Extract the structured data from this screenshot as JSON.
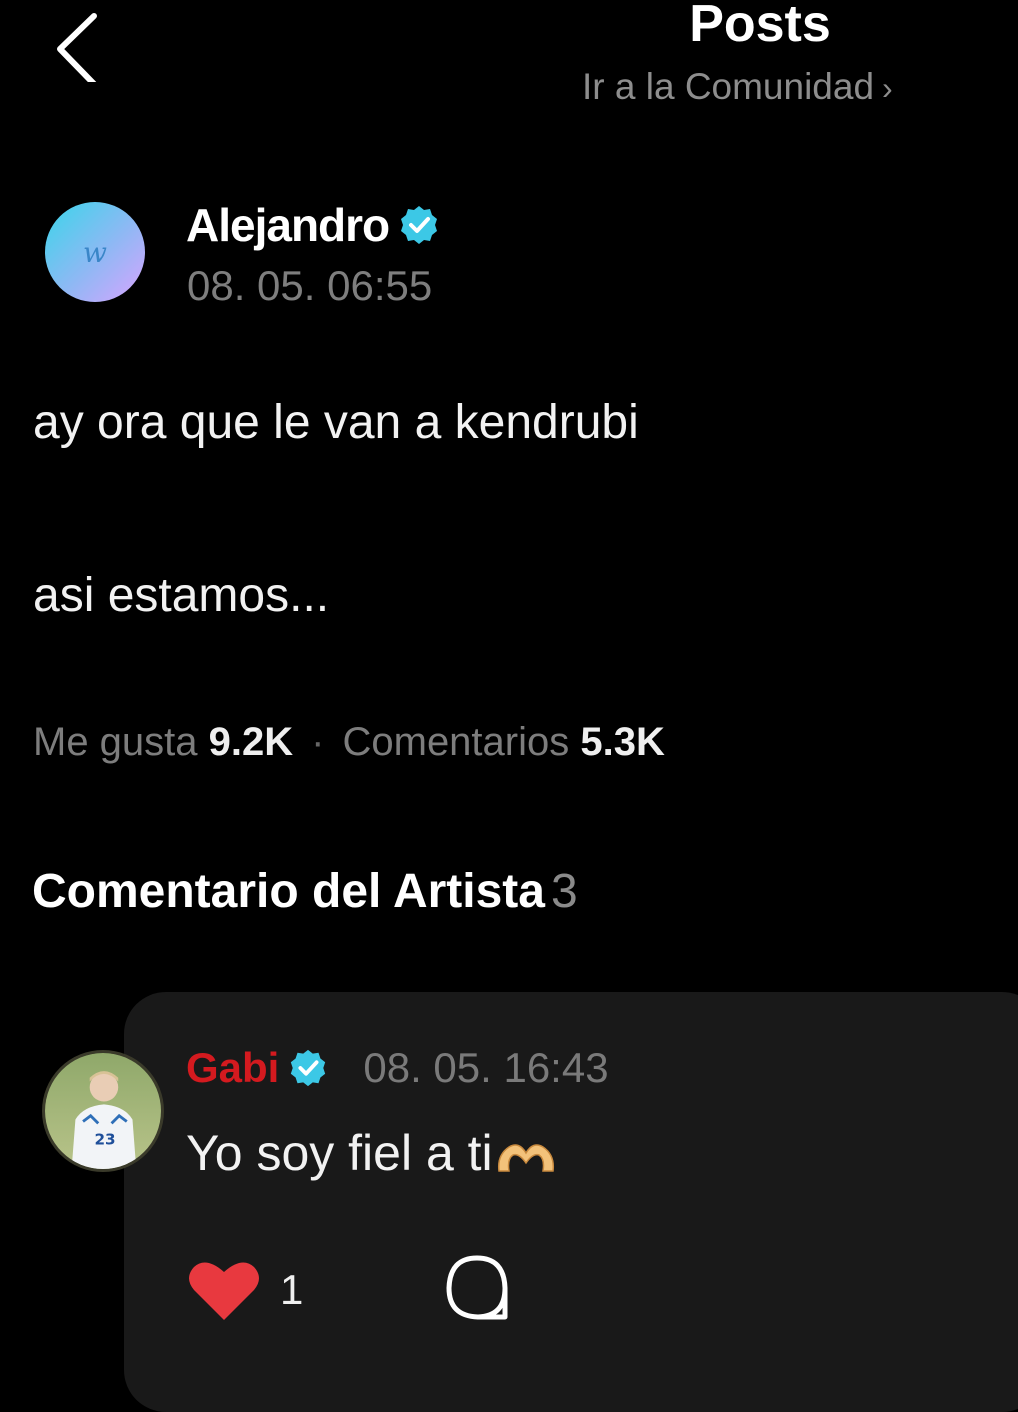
{
  "header": {
    "title": "Posts",
    "community_link": "Ir a la Comunidad",
    "back_icon": "chevron-left-icon"
  },
  "post": {
    "author": {
      "name": "Alejandro",
      "avatar_letter": "w",
      "verified": true
    },
    "timestamp": "08. 05. 06:55",
    "lines": [
      "ay ora que le van a kendrubi",
      "asi estamos..."
    ],
    "stats": {
      "likes_label": "Me gusta",
      "likes_value": "9.2K",
      "separator": "·",
      "comments_label": "Comentarios",
      "comments_value": "5.3K"
    }
  },
  "artist_comments": {
    "title": "Comentario del Artista",
    "count": "3",
    "items": [
      {
        "name": "Gabi",
        "verified": true,
        "timestamp": "08. 05. 16:43",
        "text": "Yo soy fiel a ti",
        "like_count": "1"
      }
    ]
  },
  "colors": {
    "background": "#000000",
    "card": "#191919",
    "verified": "#3cc8e6",
    "artist_name": "#d41a1f",
    "heart": "#e8393f"
  }
}
